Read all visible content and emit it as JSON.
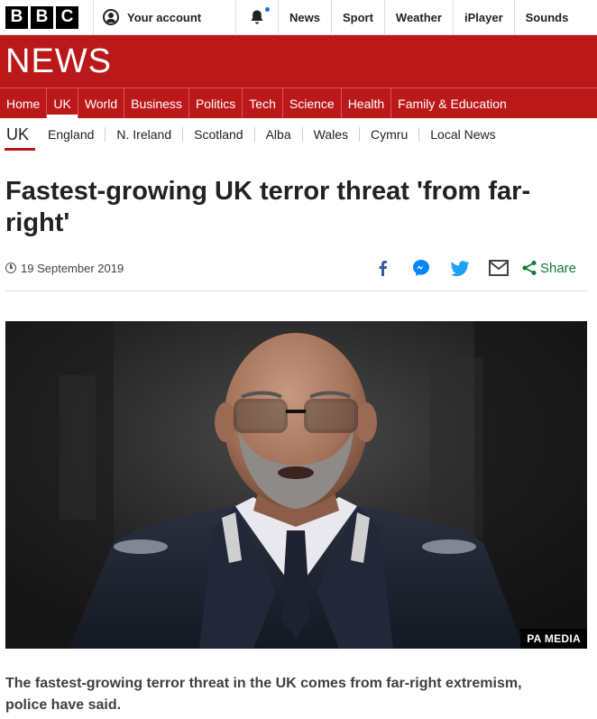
{
  "brand": {
    "letters": [
      "B",
      "B",
      "C"
    ],
    "section_word": "NEWS"
  },
  "topbar": {
    "account_label": "Your account",
    "nav": [
      "News",
      "Sport",
      "Weather",
      "iPlayer",
      "Sounds"
    ]
  },
  "section_nav": {
    "items": [
      "Home",
      "UK",
      "World",
      "Business",
      "Politics",
      "Tech",
      "Science",
      "Health",
      "Family & Education"
    ],
    "active": "UK"
  },
  "sub_nav": {
    "current": "UK",
    "items": [
      "England",
      "N. Ireland",
      "Scotland",
      "Alba",
      "Wales",
      "Cymru",
      "Local News"
    ]
  },
  "article": {
    "headline": "Fastest-growing UK terror threat 'from far-right'",
    "date": "19 September 2019",
    "share_label": "Share",
    "image_credit": "PA MEDIA",
    "intro": "The fastest-growing terror threat in the UK comes from far-right extremism, police have said."
  },
  "colors": {
    "brand_red": "#bb1919",
    "facebook": "#3b5998",
    "messenger": "#0084ff",
    "twitter": "#1da1f2",
    "share_green": "#117a36"
  },
  "icons": [
    "account-icon",
    "bell-icon",
    "clock-icon",
    "facebook-icon",
    "messenger-icon",
    "twitter-icon",
    "email-icon",
    "share-icon"
  ]
}
